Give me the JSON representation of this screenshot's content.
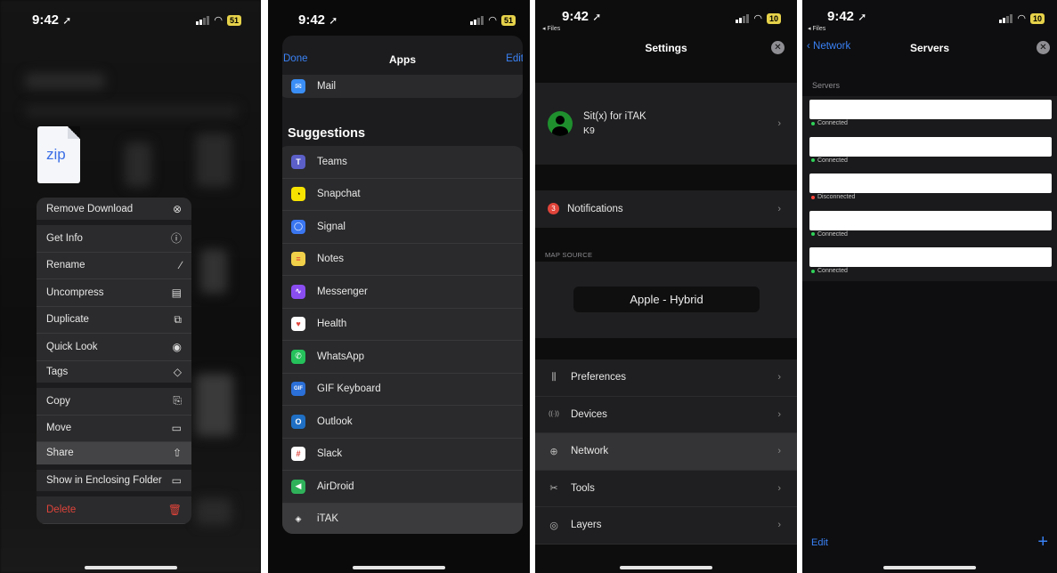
{
  "status_bar": {
    "time": "9:42",
    "location_glyph": "➚"
  },
  "panel1": {
    "battery": "51",
    "file_type_label": "zip",
    "menu_items": [
      {
        "label": "Remove Download",
        "icon": "⊗",
        "name": "remove-download"
      },
      {
        "label": "Get Info",
        "icon": "ⓘ",
        "name": "get-info"
      },
      {
        "label": "Rename",
        "icon": "∕",
        "name": "rename"
      },
      {
        "label": "Uncompress",
        "icon": "▤",
        "name": "uncompress"
      },
      {
        "label": "Duplicate",
        "icon": "⧉",
        "name": "duplicate"
      },
      {
        "label": "Quick Look",
        "icon": "◉",
        "name": "quick-look"
      },
      {
        "label": "Tags",
        "icon": "◇",
        "name": "tags"
      },
      {
        "label": "Copy",
        "icon": "⎘",
        "name": "copy"
      },
      {
        "label": "Move",
        "icon": "▭",
        "name": "move"
      },
      {
        "label": "Share",
        "icon": "⇧",
        "name": "share"
      },
      {
        "label": "Show in Enclosing Folder",
        "icon": "▭",
        "name": "show-in-enclosing-folder"
      },
      {
        "label": "Delete",
        "icon": "🗑",
        "name": "delete"
      }
    ]
  },
  "panel2": {
    "battery": "51",
    "nav": {
      "done": "Done",
      "title": "Apps",
      "edit": "Edit"
    },
    "mail_label": "Mail",
    "suggestions_title": "Suggestions",
    "apps": [
      {
        "name": "Teams",
        "color": "#5b5fc7",
        "glyph": "T"
      },
      {
        "name": "Snapchat",
        "color": "#f7e300",
        "glyph": "◔"
      },
      {
        "name": "Signal",
        "color": "#3a76f0",
        "glyph": "◯"
      },
      {
        "name": "Notes",
        "color": "#f2d14a",
        "glyph": "≡"
      },
      {
        "name": "Messenger",
        "color": "#8a4df0",
        "glyph": "∿"
      },
      {
        "name": "Health",
        "color": "#ffffff",
        "glyph": "♥"
      },
      {
        "name": "WhatsApp",
        "color": "#25c15b",
        "glyph": "✆"
      },
      {
        "name": "GIF Keyboard",
        "color": "#2b6fd8",
        "glyph": "GIF"
      },
      {
        "name": "Outlook",
        "color": "#1f6fc4",
        "glyph": "O"
      },
      {
        "name": "Slack",
        "color": "#ffffff",
        "glyph": "#"
      },
      {
        "name": "AirDroid",
        "color": "#2fb15a",
        "glyph": "◀"
      },
      {
        "name": "iTAK",
        "color": "#3b3b3d",
        "glyph": "◈"
      }
    ]
  },
  "panel3": {
    "back_label": "◂ Files",
    "battery": "10",
    "title": "Settings",
    "close_glyph": "✕",
    "profile": {
      "name": "Sit(x) for iTAK",
      "sub": "K9"
    },
    "notifications": {
      "badge": "3",
      "label": "Notifications"
    },
    "map_source_header": "MAP SOURCE",
    "map_source_value": "Apple - Hybrid",
    "menu": [
      {
        "label": "Preferences",
        "icon": "⫼",
        "name": "preferences"
      },
      {
        "label": "Devices",
        "icon": "((·))",
        "name": "devices"
      },
      {
        "label": "Network",
        "icon": "⊕",
        "name": "network"
      },
      {
        "label": "Tools",
        "icon": "✂",
        "name": "tools"
      },
      {
        "label": "Layers",
        "icon": "◎",
        "name": "layers"
      }
    ]
  },
  "panel4": {
    "back_label": "◂ Files",
    "battery": "10",
    "nav": {
      "back": "Network",
      "title": "Servers",
      "close": "✕"
    },
    "section_header": "Servers",
    "servers": [
      {
        "status": "Connected",
        "color": "#30d158"
      },
      {
        "status": "Connected",
        "color": "#30d158"
      },
      {
        "status": "Disconnected",
        "color": "#ff453a"
      },
      {
        "status": "Connected",
        "color": "#30d158"
      },
      {
        "status": "Connected",
        "color": "#30d158"
      }
    ],
    "edit": "Edit",
    "add": "+"
  }
}
